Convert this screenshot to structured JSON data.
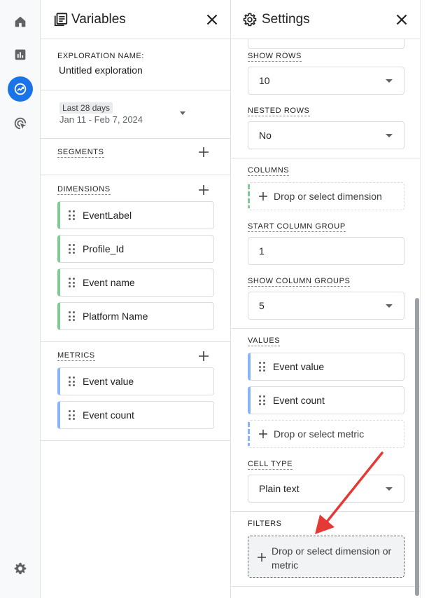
{
  "nav": {
    "items": [
      {
        "name": "home",
        "icon": "home-icon"
      },
      {
        "name": "reports",
        "icon": "bar-chart-icon"
      },
      {
        "name": "explore",
        "icon": "explore-trend-icon",
        "active": true
      },
      {
        "name": "advertising",
        "icon": "target-cursor-icon"
      }
    ],
    "settings_icon": "gear-icon",
    "active_color": "#1a73e8"
  },
  "variables": {
    "title": "Variables",
    "exploration_name_label": "EXPLORATION NAME:",
    "exploration_name_value": "Untitled exploration",
    "date_chip": "Last 28 days",
    "date_range": "Jan 11 - Feb 7, 2024",
    "segments_label": "SEGMENTS",
    "dimensions_label": "DIMENSIONS",
    "dimensions": [
      "EventLabel",
      "Profile_Id",
      "Event name",
      "Platform Name"
    ],
    "metrics_label": "METRICS",
    "metrics": [
      "Event value",
      "Event count"
    ],
    "dimension_color": "#81c995",
    "metric_color": "#8ab4f8"
  },
  "settings": {
    "title": "Settings",
    "show_rows_label": "SHOW ROWS",
    "show_rows_value": "10",
    "nested_rows_label": "NESTED ROWS",
    "nested_rows_value": "No",
    "columns_label": "COLUMNS",
    "columns_placeholder": "Drop or select dimension",
    "start_column_group_label": "START COLUMN GROUP",
    "start_column_group_value": "1",
    "show_column_groups_label": "SHOW COLUMN GROUPS",
    "show_column_groups_value": "5",
    "values_label": "VALUES",
    "values": [
      "Event value",
      "Event count"
    ],
    "values_placeholder": "Drop or select metric",
    "cell_type_label": "CELL TYPE",
    "cell_type_value": "Plain text",
    "filters_label": "FILTERS",
    "filters_placeholder": "Drop or select dimension or metric"
  },
  "annotation_color": "#e53935"
}
